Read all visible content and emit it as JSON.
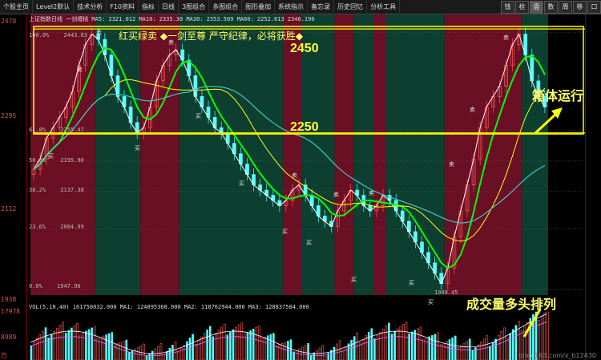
{
  "toolbar": {
    "items": [
      "个股主页",
      "Level2默认",
      "技术分析",
      "F10资料",
      "指标",
      "日线",
      "3图组合",
      "多图组合",
      "图形叠加",
      "系统指示",
      "备忘录",
      "历史回忆",
      "分析工具"
    ],
    "right_buttons": [
      "钱",
      "栓",
      "盘",
      "数",
      "周",
      "移",
      "口"
    ]
  },
  "info": {
    "text": "上证指数日线  一剑缠桃  MA5: 2321.012  MA10: 2335.30  MA30: 2353.509  MA60: 2252.013  2346.196"
  },
  "slogan": "红买绿卖  ◆一剑至尊  严守纪律，必将获胜◆",
  "levels": {
    "upper": "2450",
    "lower": "2250"
  },
  "annotations": {
    "box": "箱体运行",
    "volume": "成交量多头排列"
  },
  "y_axis": [
    "2478",
    "2295",
    "2112",
    "1938"
  ],
  "vol_axis": [
    "17978",
    "8989",
    "万"
  ],
  "fib_labels": [
    {
      "pct": "100.0%",
      "val": "2443.83"
    },
    {
      "pct": "61.8%",
      "val": "2255.47"
    },
    {
      "pct": "50.0%",
      "val": "2195.90"
    },
    {
      "pct": "38.2%",
      "val": "2137.38"
    },
    {
      "pct": "23.6%",
      "val": "2064.99"
    },
    {
      "pct": "0.0%",
      "val": "1947.96"
    }
  ],
  "low_label": "1949.45",
  "vol_info": "VOL(5,10,40)  161750032.000  MA1: 124895368.000  MA2: 118762944.000  MA3: 128837584.000",
  "signal_buy": "买",
  "signal_sell": "卖",
  "watermark": "blog.163.com/x_b12430",
  "chart_data": {
    "type": "candlestick",
    "title": "上证指数",
    "ylim": [
      1938,
      2478
    ],
    "y_ticks": [
      2478,
      2295,
      2112,
      1938
    ],
    "closes": [
      2180,
      2200,
      2240,
      2260,
      2280,
      2300,
      2330,
      2380,
      2420,
      2440,
      2430,
      2400,
      2360,
      2320,
      2300,
      2270,
      2250,
      2260,
      2300,
      2350,
      2380,
      2400,
      2410,
      2390,
      2360,
      2320,
      2300,
      2280,
      2260,
      2250,
      2230,
      2210,
      2190,
      2170,
      2150,
      2140,
      2130,
      2120,
      2110,
      2120,
      2140,
      2150,
      2130,
      2110,
      2090,
      2080,
      2070,
      2100,
      2120,
      2140,
      2130,
      2110,
      2100,
      2110,
      2130,
      2120,
      2100,
      2080,
      2060,
      2040,
      2020,
      2000,
      1980,
      1960,
      1990,
      2050,
      2100,
      2150,
      2200,
      2260,
      2300,
      2320,
      2340,
      2380,
      2420,
      2440,
      2400,
      2350,
      2320,
      2300
    ]
  }
}
